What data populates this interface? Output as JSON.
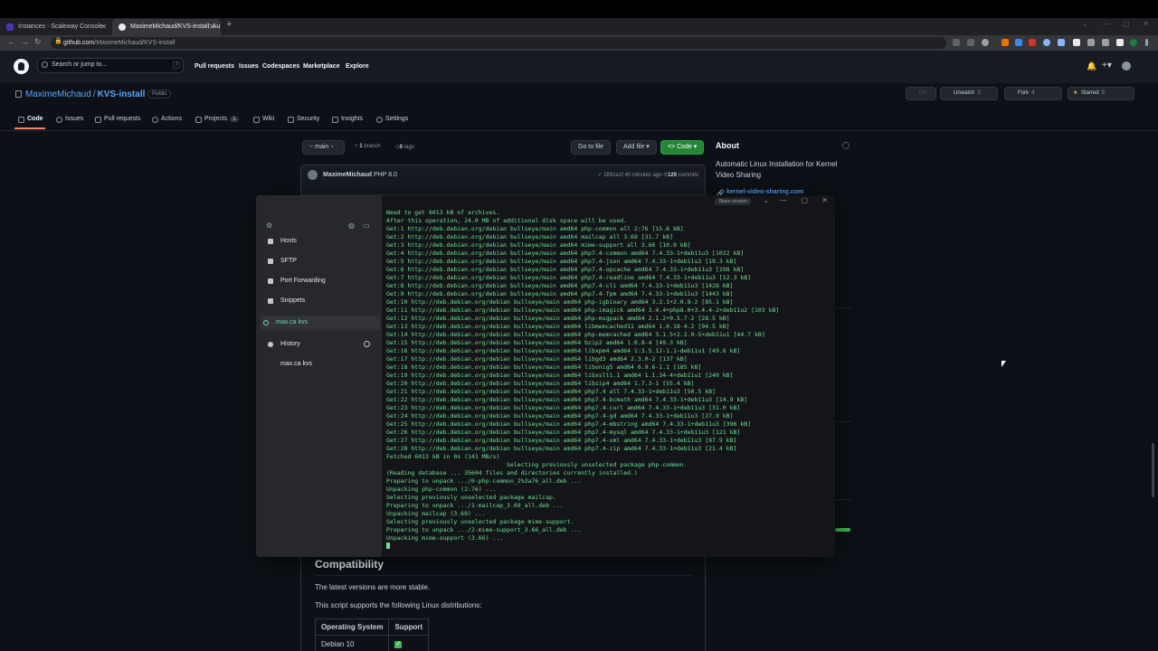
{
  "browser": {
    "tabs": [
      {
        "title": "Instances - Scaleway Console"
      },
      {
        "title": "MaximeMichaud/KVS-install: Au"
      }
    ],
    "new_tab": "+",
    "url_host": "github.com",
    "url_path": "/MaximeMichaud/KVS-install",
    "window_controls": [
      "⌄",
      "—",
      "▢",
      "✕"
    ]
  },
  "github_header": {
    "search_placeholder": "Search or jump to...",
    "search_shortcut": "/",
    "nav": [
      "Pull requests",
      "Issues",
      "Codespaces",
      "Marketplace",
      "Explore"
    ],
    "right_icons": [
      "bell-icon",
      "plus-icon",
      "avatar"
    ]
  },
  "repo": {
    "owner": "MaximeMichaud",
    "name": "KVS-install",
    "visibility": "Public",
    "actions": [
      {
        "label": "Pin",
        "count": ""
      },
      {
        "label": "Unwatch",
        "count": "3"
      },
      {
        "label": "Fork",
        "count": "4"
      },
      {
        "label": "Starred",
        "count": "5"
      }
    ],
    "tabs": [
      {
        "label": "Code",
        "count": ""
      },
      {
        "label": "Issues",
        "count": ""
      },
      {
        "label": "Pull requests",
        "count": ""
      },
      {
        "label": "Actions",
        "count": ""
      },
      {
        "label": "Projects",
        "count": "1"
      },
      {
        "label": "Wiki",
        "count": ""
      },
      {
        "label": "Security",
        "count": ""
      },
      {
        "label": "Insights",
        "count": ""
      },
      {
        "label": "Settings",
        "count": ""
      }
    ]
  },
  "filenav": {
    "branch": "main",
    "branches_count": "1",
    "branches_label": "branch",
    "tags_count": "0",
    "tags_label": "tags",
    "go_to_file": "Go to file",
    "add_file": "Add file",
    "code": "Code"
  },
  "commit": {
    "user": "MaximeMichaud",
    "message": "PHP 8.0",
    "hash": "1891e1f",
    "time": "40 minutes ago",
    "commits_count": "129",
    "commits_label": "commits"
  },
  "about": {
    "title": "About",
    "description": "Automatic Linux Installation for Kernel Video Sharing",
    "link": "kernel-video-sharing.com"
  },
  "readme": {
    "compat_title": "Compatibility",
    "p1": "The latest versions are more stable.",
    "p2": "This script supports the following Linux distributions:",
    "table_headers": [
      "Operating System",
      "Support"
    ],
    "table_rows": [
      [
        "Debian 10",
        "✓"
      ]
    ]
  },
  "termius": {
    "share_label": "Share session",
    "sidebar": [
      {
        "label": "Hosts",
        "icon": "hosts-icon"
      },
      {
        "label": "SFTP",
        "icon": "folder-icon"
      },
      {
        "label": "Port Forwarding",
        "icon": "arrow-icon"
      },
      {
        "label": "Snippets",
        "icon": "code-icon"
      },
      {
        "label": "max.ca kvs",
        "icon": "session-icon",
        "active": true
      },
      {
        "label": "History",
        "icon": "history-icon"
      },
      {
        "label": "max.ca kvs",
        "icon": ""
      }
    ],
    "terminal_lines": [
      "Need to get 6013 kB of archives.",
      "After this operation, 24.0 MB of additional disk space will be used.",
      "Get:1 http://deb.debian.org/debian bullseye/main amd64 php-common all 2:76 [15.6 kB]",
      "Get:2 http://deb.debian.org/debian bullseye/main amd64 mailcap all 3.69 [31.7 kB]",
      "Get:3 http://deb.debian.org/debian bullseye/main amd64 mime-support all 3.66 [10.9 kB]",
      "Get:4 http://deb.debian.org/debian bullseye/main amd64 php7.4-common amd64 7.4.33-1+deb11u3 [1022 kB]",
      "Get:5 http://deb.debian.org/debian bullseye/main amd64 php7.4-json amd64 7.4.33-1+deb11u3 [19.3 kB]",
      "Get:6 http://deb.debian.org/debian bullseye/main amd64 php7.4-opcache amd64 7.4.33-1+deb11u3 [198 kB]",
      "Get:7 http://deb.debian.org/debian bullseye/main amd64 php7.4-readline amd64 7.4.33-1+deb11u3 [12.3 kB]",
      "Get:8 http://deb.debian.org/debian bullseye/main amd64 php7.4-cli amd64 7.4.33-1+deb11u3 [1428 kB]",
      "Get:9 http://deb.debian.org/debian bullseye/main amd64 php7.4-fpm amd64 7.4.33-1+deb11u3 [1443 kB]",
      "Get:10 http://deb.debian.org/debian bullseye/main amd64 php-igbinary amd64 3.2.1+2.0.8-2 [85.1 kB]",
      "Get:11 http://deb.debian.org/debian bullseye/main amd64 php-imagick amd64 3.4.4+php8.0+3.4.4-2+deb11u2 [103 kB]",
      "Get:12 http://deb.debian.org/debian bullseye/main amd64 php-msgpack amd64 2.1.2+0.5.7-2 [28.5 kB]",
      "Get:13 http://deb.debian.org/debian bullseye/main amd64 libmemcached11 amd64 1.0.18-4.2 [94.5 kB]",
      "Get:14 http://deb.debian.org/debian bullseye/main amd64 php-memcached amd64 3.1.5+2.2.0-5+deb11u1 [44.7 kB]",
      "Get:15 http://deb.debian.org/debian bullseye/main amd64 bzip2 amd64 1.0.8-4 [49.3 kB]",
      "Get:16 http://deb.debian.org/debian bullseye/main amd64 libxpm4 amd64 1:3.5.12-1.1~deb11u1 [49.6 kB]",
      "Get:17 http://deb.debian.org/debian bullseye/main amd64 libgd3 amd64 2.3.0-2 [137 kB]",
      "Get:18 http://deb.debian.org/debian bullseye/main amd64 libonig5 amd64 6.9.6-1.1 [185 kB]",
      "Get:19 http://deb.debian.org/debian bullseye/main amd64 libxslt1.1 amd64 1.1.34-4+deb11u1 [240 kB]",
      "Get:20 http://deb.debian.org/debian bullseye/main amd64 libzip4 amd64 1.7.3-1 [55.4 kB]",
      "Get:21 http://deb.debian.org/debian bullseye/main amd64 php7.4 all 7.4.33-1+deb11u3 [50.5 kB]",
      "Get:22 http://deb.debian.org/debian bullseye/main amd64 php7.4-bcmath amd64 7.4.33-1+deb11u3 [14.9 kB]",
      "Get:23 http://deb.debian.org/debian bullseye/main amd64 php7.4-curl amd64 7.4.33-1+deb11u3 [31.0 kB]",
      "Get:24 http://deb.debian.org/debian bullseye/main amd64 php7.4-gd amd64 7.4.33-1+deb11u3 [27.9 kB]",
      "Get:25 http://deb.debian.org/debian bullseye/main amd64 php7.4-mbstring amd64 7.4.33-1+deb11u3 [396 kB]",
      "Get:26 http://deb.debian.org/debian bullseye/main amd64 php7.4-mysql amd64 7.4.33-1+deb11u3 [121 kB]",
      "Get:27 http://deb.debian.org/debian bullseye/main amd64 php7.4-xml amd64 7.4.33-1+deb11u3 [97.9 kB]",
      "Get:28 http://deb.debian.org/debian bullseye/main amd64 php7.4-zip amd64 7.4.33-1+deb11u3 [21.4 kB]",
      "Fetched 6013 kB in 0s (141 MB/s)",
      "                                  Selecting previously unselected package php-common.",
      "(Reading database ... 35604 files and directories currently installed.)",
      "Preparing to unpack .../0-php-common_2%3a76_all.deb ...",
      "Unpacking php-common (2:76) ...",
      "Selecting previously unselected package mailcap.",
      "Preparing to unpack .../1-mailcap_3.69_all.deb ...",
      "Unpacking mailcap (3.69) ...",
      "Selecting previously unselected package mime-support.",
      "Preparing to unpack .../2-mime-support_3.66_all.deb ...",
      "Unpacking mime-support (3.66) ..."
    ]
  },
  "colors": {
    "accent_blue": "#58a6ff",
    "code_green": "#238636",
    "terminal_green": "#6be08e",
    "tab_underline": "#f78166"
  }
}
